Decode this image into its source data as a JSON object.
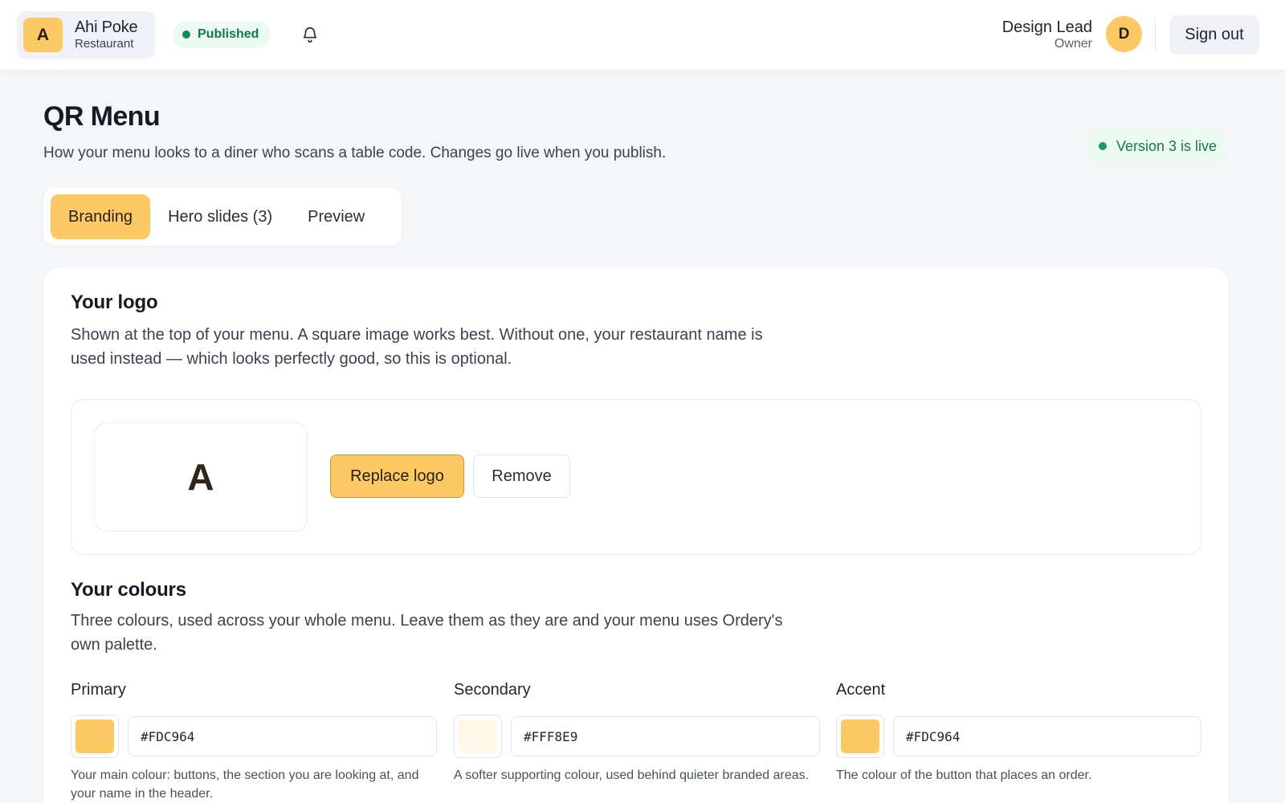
{
  "header": {
    "brand_initial": "A",
    "brand_name": "Ahi Poke",
    "brand_sub": "Restaurant",
    "status": "Published",
    "bell_icon": "bell-icon",
    "user_name": "Design Lead",
    "user_role": "Owner",
    "user_initial": "D",
    "signout_label": "Sign out"
  },
  "page": {
    "title": "QR Menu",
    "subtitle": "How your menu looks to a diner who scans a table code. Changes go live when you publish.",
    "version_status": "Version 3 is live"
  },
  "tabs": [
    {
      "label": "Branding",
      "active": true
    },
    {
      "label": "Hero slides (3)",
      "active": false
    },
    {
      "label": "Preview",
      "active": false
    }
  ],
  "logo_section": {
    "title": "Your logo",
    "description": "Shown at the top of your menu. A square image works best. Without one, your restaurant name is used instead — which looks perfectly good, so this is optional.",
    "preview_letter": "A",
    "replace_label": "Replace logo",
    "remove_label": "Remove"
  },
  "colours_section": {
    "title": "Your colours",
    "description": "Three colours, used across your whole menu. Leave them as they are and your menu uses Ordery's own palette.",
    "colours": [
      {
        "label": "Primary",
        "hex": "#FDC964",
        "help": "Your main colour: buttons, the section you are looking at, and your name in the header."
      },
      {
        "label": "Secondary",
        "hex": "#FFF8E9",
        "help": "A softer supporting colour, used behind quieter branded areas."
      },
      {
        "label": "Accent",
        "hex": "#FDC964",
        "help": "The colour of the button that places an order."
      }
    ]
  },
  "theme": {
    "accent": "#FDC964",
    "success": "#137A47",
    "background": "#F5F6F8"
  }
}
